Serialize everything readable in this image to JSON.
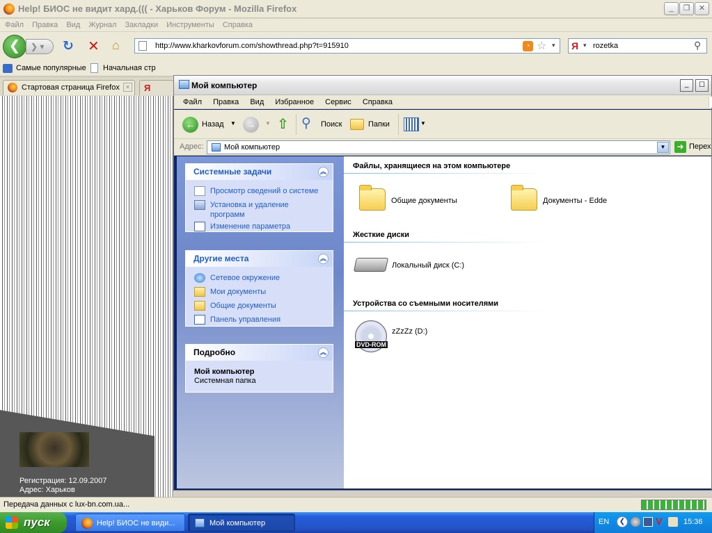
{
  "firefox": {
    "title": "Help! БИОС не видит хард.((( - Харьков Форум - Mozilla Firefox",
    "menu": [
      "Файл",
      "Правка",
      "Вид",
      "Журнал",
      "Закладки",
      "Инструменты",
      "Справка"
    ],
    "url": "http://www.kharkovforum.com/showthread.php?t=915910",
    "search_value": "rozetka",
    "search_engine_glyph": "Я",
    "bookmarks": [
      "Самые популярные",
      "Начальная стр"
    ],
    "tabs": [
      "Стартовая страница Firefox",
      "Я"
    ],
    "status": "Передача данных с lux-bn.com.ua...",
    "forum_user": {
      "registered": "Регистрация: 12.09.2007",
      "address": "Адрес: Харьков"
    }
  },
  "explorer": {
    "title": "Мой компьютер",
    "menu": [
      "Файл",
      "Правка",
      "Вид",
      "Избранное",
      "Сервис",
      "Справка"
    ],
    "toolbar": {
      "back": "Назад",
      "search": "Поиск",
      "folders": "Папки"
    },
    "address_label": "Адрес:",
    "address_value": "Мой компьютер",
    "go_label": "Перех",
    "panels": {
      "system": {
        "title": "Системные задачи",
        "items": [
          "Просмотр сведений о системе",
          "Установка и удаление",
          "программ",
          "Изменение параметра"
        ]
      },
      "other": {
        "title": "Другие места",
        "items": [
          "Сетевое окружение",
          "Мои документы",
          "Общие документы",
          "Панель управления"
        ]
      },
      "details": {
        "title": "Подробно",
        "name": "Мой компьютер",
        "type": "Системная папка"
      }
    },
    "sections": {
      "files": {
        "title": "Файлы, хранящиеся на этом компьютере",
        "items": [
          "Общие документы",
          "Документы - Edde"
        ]
      },
      "hdd": {
        "title": "Жесткие диски",
        "items": [
          "Локальный диск (C:)"
        ]
      },
      "removable": {
        "title": "Устройства со съемными носителями",
        "items": [
          "zZzZz (D:)"
        ],
        "badge": "DVD-ROM"
      }
    }
  },
  "taskbar": {
    "start": "пуск",
    "buttons": [
      "Help! БИОС не види...",
      "Мой компьютер"
    ],
    "lang": "EN",
    "clock": "15:36"
  },
  "icons": [
    "firefox-icon",
    "back-arrow-icon",
    "forward-arrow-icon",
    "reload-icon",
    "stop-icon",
    "home-icon",
    "page-icon",
    "rss-icon",
    "star-icon",
    "magnifier-icon",
    "folder-icon",
    "up-folder-icon",
    "views-icon",
    "computer-icon",
    "hard-drive-icon",
    "dvd-icon",
    "chevron-up-icon",
    "go-arrow-icon",
    "windows-flag-icon"
  ]
}
